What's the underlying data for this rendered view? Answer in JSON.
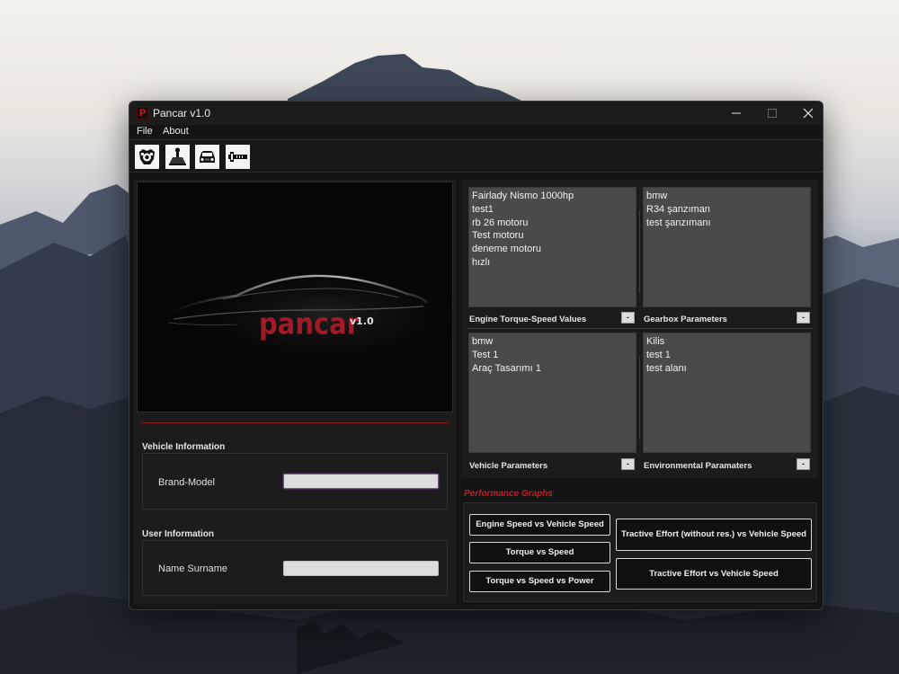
{
  "window": {
    "title": "Pancar v1.0",
    "app_icon_letter": "P"
  },
  "menu": {
    "file": "File",
    "about": "About"
  },
  "logo": {
    "word": "pancar",
    "version": "v1.0"
  },
  "vehicle_info": {
    "title": "Vehicle Information",
    "brand_model_label": "Brand-Model",
    "brand_model_value": ""
  },
  "user_info": {
    "title": "User Information",
    "name_label": "Name Surname",
    "name_value": ""
  },
  "lists": {
    "engine": {
      "title": "Engine Torque-Speed Values",
      "items": [
        "Fairlady Nismo 1000hp",
        "test1",
        "rb 26 motoru",
        "Test motoru",
        "deneme motoru",
        "hızlı"
      ]
    },
    "gearbox": {
      "title": "Gearbox Parameters",
      "items": [
        "bmw",
        "R34 şanzıman",
        "test şanzımanı"
      ]
    },
    "vehicle": {
      "title": "Vehicle Parameters",
      "items": [
        "bmw",
        "Test 1",
        "Araç Tasarımı 1"
      ]
    },
    "environment": {
      "title": "Environmental Paramaters",
      "items": [
        "Kilis",
        "test 1",
        "test alanı"
      ]
    },
    "remove_label": "-"
  },
  "performance": {
    "title": "Performance Graphs",
    "buttons": {
      "engine_vs_vehicle": "Engine Speed vs Vehicle Speed",
      "torque_vs_speed": "Torque vs Speed",
      "torque_speed_power": "Torque vs Speed vs Power",
      "tractive_no_res": "Tractive Effort (without res.) vs Vehicle Speed",
      "tractive": "Tractive Effort vs Vehicle Speed"
    }
  },
  "icons": {
    "toolbar": [
      "engine-icon",
      "gear-shifter-icon",
      "car-front-icon",
      "driveshaft-icon"
    ]
  },
  "colors": {
    "accent_red": "#a11a27",
    "title_red": "#c41c24",
    "window_bg": "#141414",
    "panel_bg": "#1c1c1c",
    "list_bg": "#4a4a4a"
  }
}
